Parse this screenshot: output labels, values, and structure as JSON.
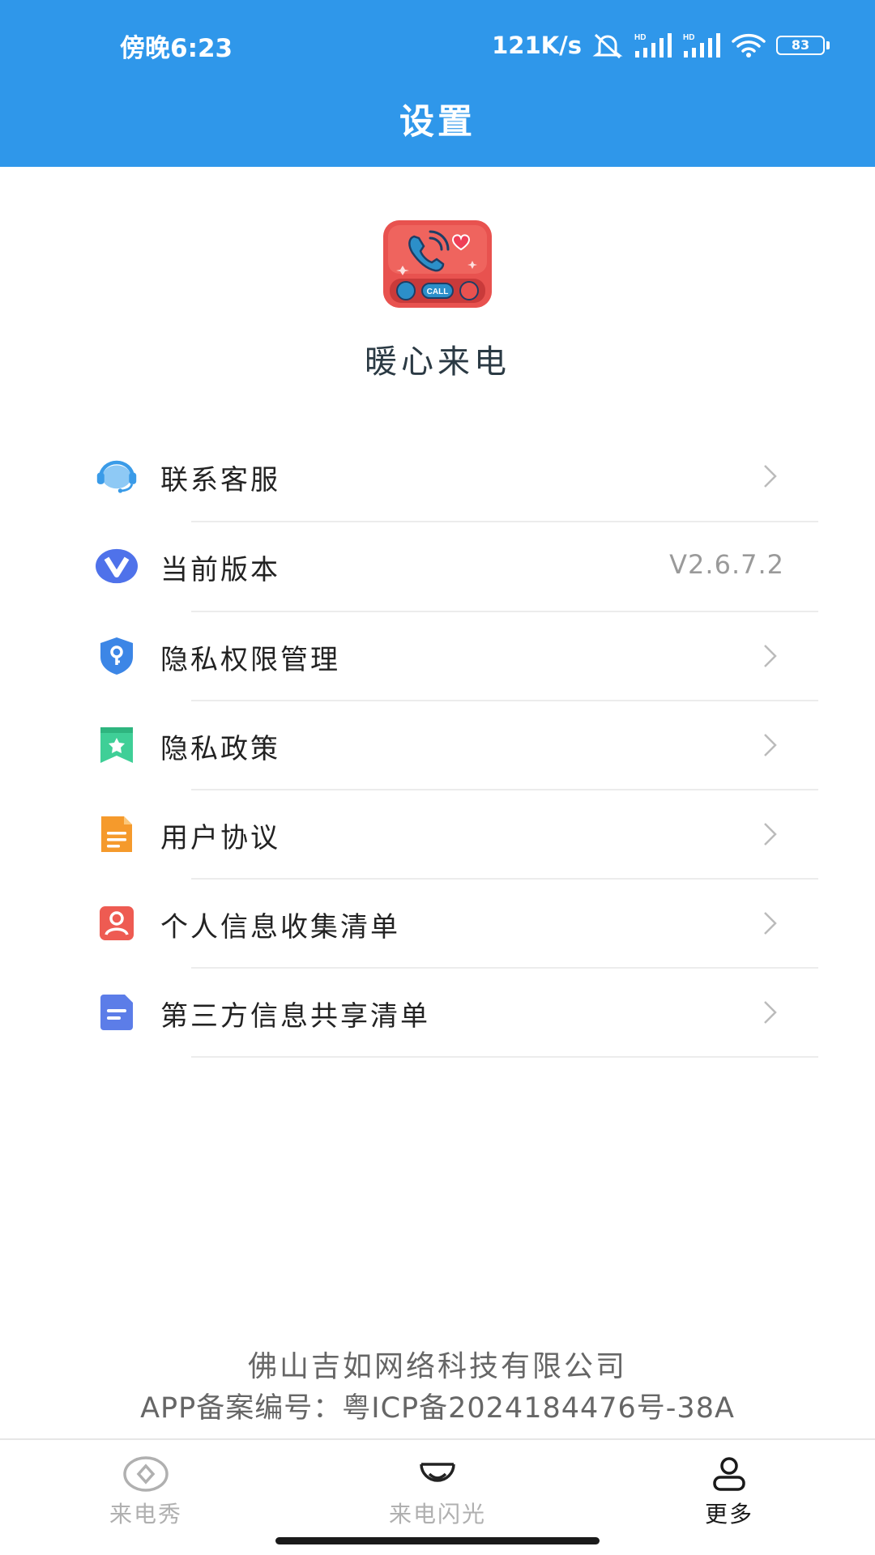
{
  "status_bar": {
    "time": "傍晚6:23",
    "net_speed": "121K/s",
    "battery": "83",
    "signal_label": "HD"
  },
  "header": {
    "title": "设置"
  },
  "app": {
    "name": "暖心来电",
    "logo_text": "CALL"
  },
  "menu": [
    {
      "label": "联系客服",
      "icon": "headset-icon",
      "value": ""
    },
    {
      "label": "当前版本",
      "icon": "version-v-icon",
      "value": "V2.6.7.2"
    },
    {
      "label": "隐私权限管理",
      "icon": "shield-key-icon",
      "value": ""
    },
    {
      "label": "隐私政策",
      "icon": "bookmark-star-icon",
      "value": ""
    },
    {
      "label": "用户协议",
      "icon": "document-icon",
      "value": ""
    },
    {
      "label": "个人信息收集清单",
      "icon": "person-card-icon",
      "value": ""
    },
    {
      "label": "第三方信息共享清单",
      "icon": "list-doc-icon",
      "value": ""
    }
  ],
  "footer": {
    "company": "佛山吉如网络科技有限公司",
    "icp": "APP备案编号：粤ICP备2024184476号-38A"
  },
  "tabbar": {
    "tabs": [
      {
        "label": "来电秀",
        "icon": "diamond-circle-icon",
        "active": false
      },
      {
        "label": "来电闪光",
        "icon": "smile-face-icon",
        "active": false
      },
      {
        "label": "更多",
        "icon": "person-icon",
        "active": true
      }
    ]
  },
  "colors": {
    "header_bg": "#2f97ea",
    "text_primary": "#222222",
    "text_secondary": "#9a9a9a",
    "tab_inactive": "#b0b0b0",
    "tab_active": "#1a1a1a"
  }
}
